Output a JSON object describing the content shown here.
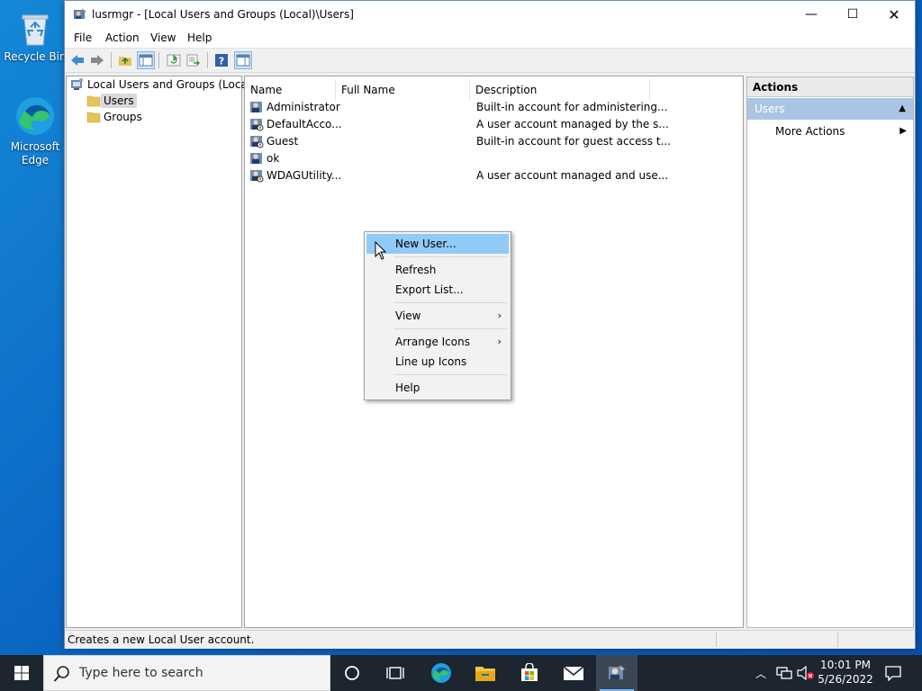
{
  "desktop": {
    "icons": [
      {
        "label": "Recycle Bin"
      },
      {
        "label": "Microsoft Edge"
      }
    ]
  },
  "window": {
    "title": "lusrmgr - [Local Users and Groups (Local)\\Users]",
    "controls": {
      "minimize": "—",
      "maximize": "☐",
      "close": "✕"
    }
  },
  "menubar": {
    "items": [
      "File",
      "Action",
      "View",
      "Help"
    ]
  },
  "tree": {
    "root": "Local Users and Groups (Local)",
    "children": [
      "Users",
      "Groups"
    ],
    "selected": "Users"
  },
  "list": {
    "columns": [
      "Name",
      "Full Name",
      "Description"
    ],
    "rows": [
      {
        "name": "Administrator",
        "full_name": "",
        "description": "Built-in account for administering..."
      },
      {
        "name": "DefaultAcco...",
        "full_name": "",
        "description": "A user account managed by the s..."
      },
      {
        "name": "Guest",
        "full_name": "",
        "description": "Built-in account for guest access t..."
      },
      {
        "name": "ok",
        "full_name": "",
        "description": ""
      },
      {
        "name": "WDAGUtility...",
        "full_name": "",
        "description": "A user account managed and use..."
      }
    ]
  },
  "actions": {
    "header": "Actions",
    "section": "Users",
    "items": [
      {
        "label": "More Actions",
        "has_submenu": true
      }
    ]
  },
  "context_menu": {
    "items": [
      {
        "label": "New User...",
        "highlighted": true
      },
      {
        "label": "Refresh"
      },
      {
        "label": "Export List..."
      },
      {
        "label": "View",
        "submenu": true
      },
      {
        "label": "Arrange Icons",
        "submenu": true
      },
      {
        "label": "Line up Icons"
      },
      {
        "label": "Help"
      }
    ]
  },
  "statusbar": {
    "text": "Creates a new Local User account."
  },
  "taskbar": {
    "search_placeholder": "Type here to search",
    "time": "10:01 PM",
    "date": "5/26/2022",
    "pinned": [
      "cortana-icon",
      "task-view-icon",
      "edge-icon",
      "file-explorer-icon",
      "store-icon",
      "mail-icon",
      "lusrmgr-icon"
    ],
    "accent": "#77b9ee"
  },
  "colors": {
    "selection_highlight": "#91c9f7",
    "actions_section": "#a9c5e3",
    "desktop": "#0a64c0"
  }
}
